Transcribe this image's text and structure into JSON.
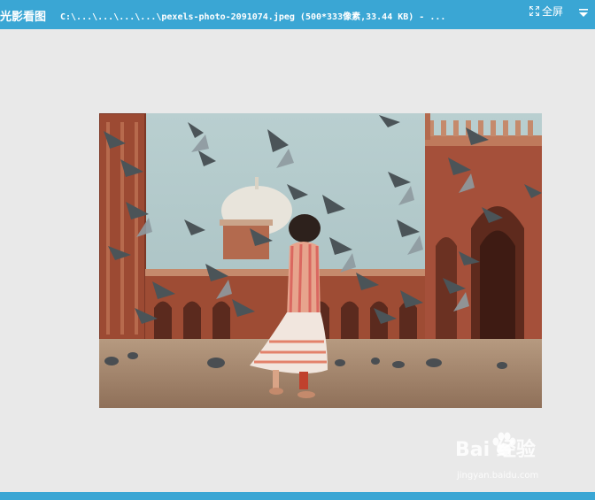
{
  "window": {
    "app_name": "光影看图",
    "file_path": "C:\\...\\...\\...\\...\\pexels-photo-2091074.jpeg (500*333像素,33.44 KB) - ...",
    "fullscreen_label": "全屏"
  },
  "icons": {
    "fullscreen": "fullscreen-icon",
    "menu": "dropdown-menu-icon"
  },
  "watermark": {
    "brand": "Bai  经验",
    "url": "jingyan.baidu.com"
  },
  "colors": {
    "accent": "#3aa6d4",
    "background": "#e9e9e9"
  }
}
